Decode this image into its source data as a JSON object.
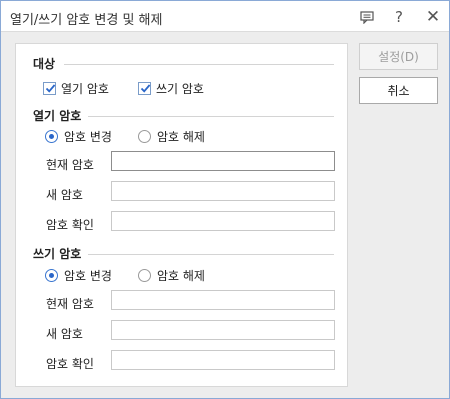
{
  "window": {
    "title": "열기/쓰기 암호 변경 및 해제",
    "icons": [
      "memo-icon",
      "help-icon",
      "close-icon"
    ]
  },
  "target": {
    "title": "대상",
    "open_label": "열기 암호",
    "open_checked": true,
    "write_label": "쓰기 암호",
    "write_checked": true
  },
  "open_section": {
    "title": "열기 암호",
    "radio_change": "암호 변경",
    "radio_remove": "암호 해제",
    "selected": "암호 변경",
    "current_label": "현재 암호",
    "new_label": "새 암호",
    "confirm_label": "암호 확인"
  },
  "write_section": {
    "title": "쓰기 암호",
    "radio_change": "암호 변경",
    "radio_remove": "암호 해제",
    "selected": "암호 변경",
    "current_label": "현재 암호",
    "new_label": "새 암호",
    "confirm_label": "암호 확인"
  },
  "buttons": {
    "set_label": "설정(D)",
    "set_enabled": false,
    "cancel_label": "취소"
  },
  "colors": {
    "accent": "#2a66c9",
    "window_border": "#8aa9d6"
  }
}
